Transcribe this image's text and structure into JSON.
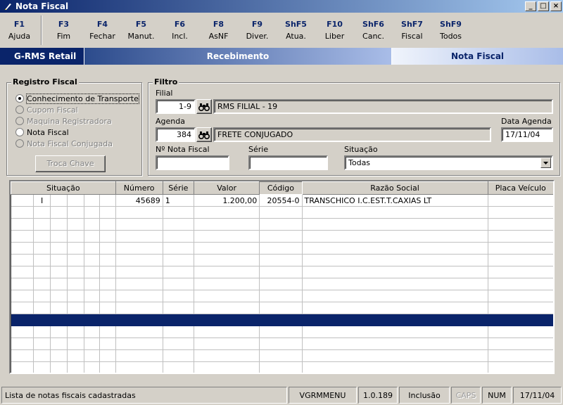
{
  "window": {
    "title": "Nota Fiscal",
    "buttons": [
      "_",
      "□",
      "×"
    ]
  },
  "toolbar": {
    "keys": [
      {
        "key": "F1",
        "label": "Ajuda"
      },
      {
        "key": "F3",
        "label": "Fim"
      },
      {
        "key": "F4",
        "label": "Fechar"
      },
      {
        "key": "F5",
        "label": "Manut."
      },
      {
        "key": "F6",
        "label": "Incl."
      },
      {
        "key": "F8",
        "label": "AsNF"
      },
      {
        "key": "F9",
        "label": "Diver."
      },
      {
        "key": "ShF5",
        "label": "Atua."
      },
      {
        "key": "F10",
        "label": "Liber"
      },
      {
        "key": "ShF6",
        "label": "Canc."
      },
      {
        "key": "ShF7",
        "label": "Fiscal"
      },
      {
        "key": "ShF9",
        "label": "Todos"
      }
    ]
  },
  "banner": {
    "app": "G-RMS Retail",
    "module": "Recebimento",
    "screen": "Nota Fiscal"
  },
  "registro": {
    "title": "Registro Fiscal",
    "options": [
      {
        "label": "Conhecimento de Transporte",
        "checked": true,
        "enabled": true
      },
      {
        "label": "Cupom Fiscal",
        "checked": false,
        "enabled": false
      },
      {
        "label": "Maquina Registradora",
        "checked": false,
        "enabled": false
      },
      {
        "label": "Nota Fiscal",
        "checked": false,
        "enabled": true
      },
      {
        "label": "Nota Fiscal Conjugada",
        "checked": false,
        "enabled": false
      }
    ],
    "troca_label": "Troca Chave"
  },
  "filtro": {
    "title": "Filtro",
    "filial_label": "Filial",
    "filial_code": "1-9",
    "filial_name": "RMS FILIAL - 19",
    "agenda_label": "Agenda",
    "agenda_code": "384",
    "agenda_name": "FRETE CONJUGADO",
    "data_agenda_label": "Data Agenda",
    "data_agenda": "17/11/04",
    "nota_label": "Nº Nota Fiscal",
    "nota_value": "",
    "serie_label": "Série",
    "serie_value": "",
    "situacao_label": "Situação",
    "situacao_value": "Todas"
  },
  "grid": {
    "headers": [
      "Situação",
      "Número",
      "Série",
      "Valor",
      "Código",
      "Razão Social",
      "Placa Veículo"
    ],
    "rows": [
      {
        "sit": [
          "",
          "I",
          "",
          "",
          "",
          ""
        ],
        "numero": "45689",
        "serie": "1",
        "valor": "1.200,00",
        "codigo": "20554-0",
        "razao": "TRANSCHICO I.C.EST.T.CAXIAS LT",
        "placa": ""
      }
    ],
    "empty_rows": 14,
    "highlight_row_index": 10
  },
  "status": {
    "message": "Lista de notas fiscais cadastradas",
    "program": "VGRMMENU",
    "version": "1.0.189",
    "mode": "Inclusão",
    "caps": "CAPS",
    "num": "NUM",
    "date": "17/11/04"
  }
}
